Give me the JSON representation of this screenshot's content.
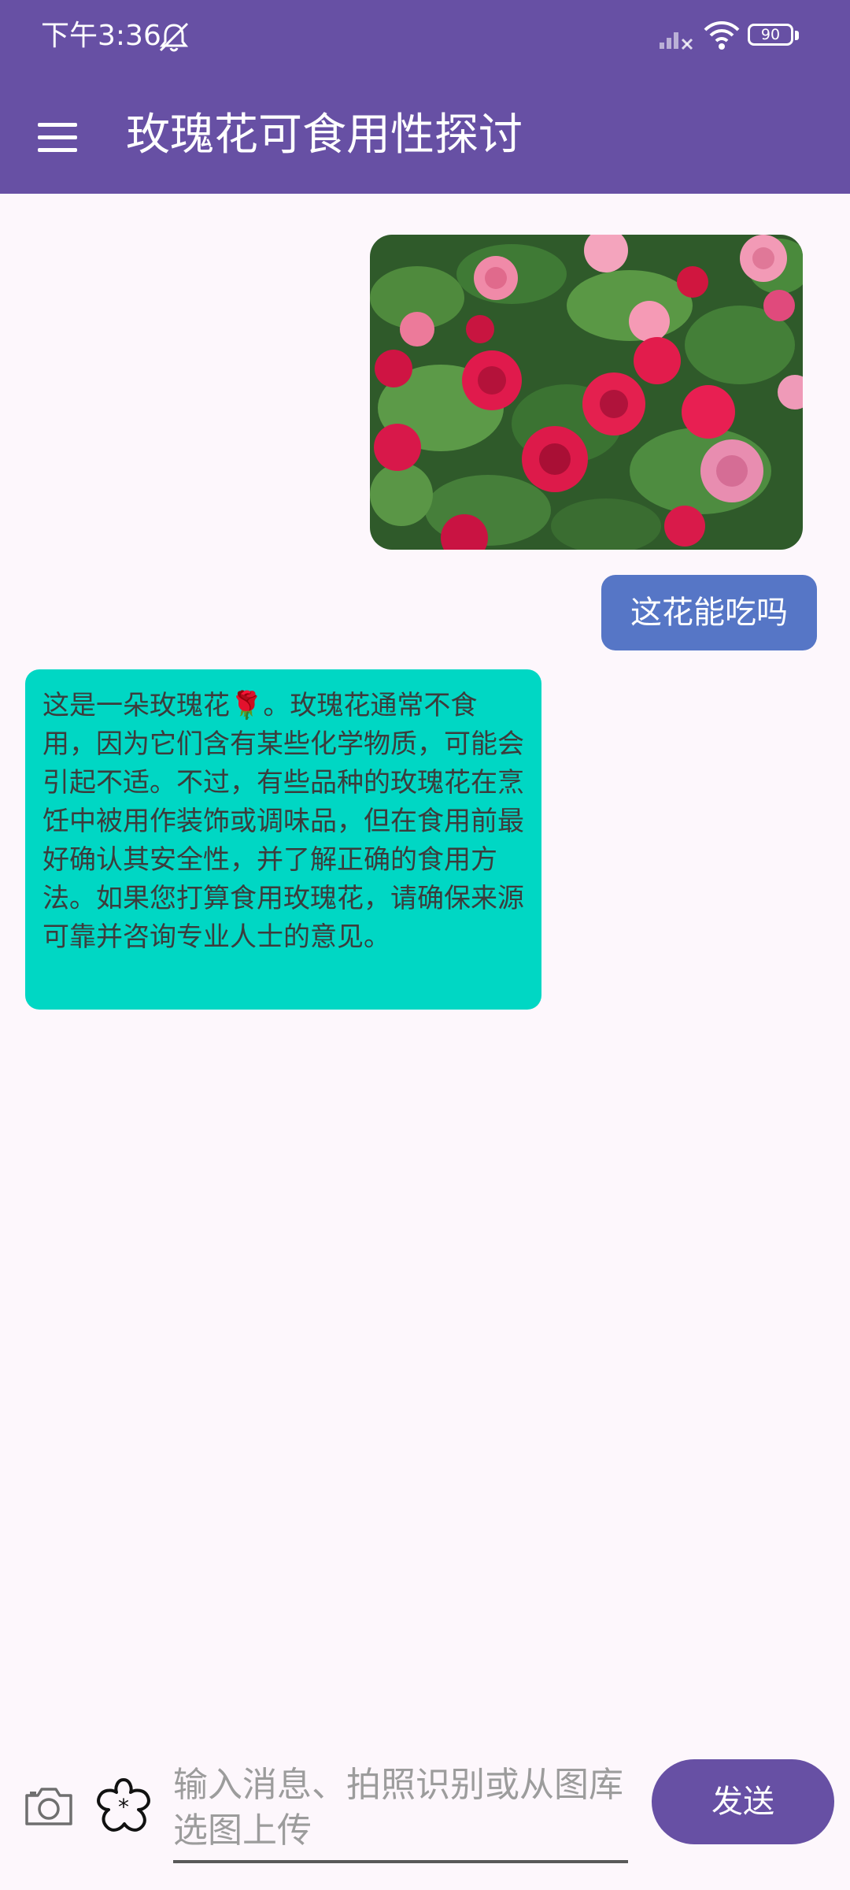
{
  "status_bar": {
    "time": "下午3:36",
    "battery": "90"
  },
  "app_bar": {
    "title": "玫瑰花可食用性探讨"
  },
  "chat": {
    "messages": [
      {
        "role": "user",
        "type": "image"
      },
      {
        "role": "user",
        "type": "text",
        "text": "这花能吃吗"
      },
      {
        "role": "assistant",
        "type": "text",
        "text": "这是一朵玫瑰花🌹。玫瑰花通常不食用，因为它们含有某些化学物质，可能会引起不适。不过，有些品种的玫瑰花在烹饪中被用作装饰或调味品，但在食用前最好确认其安全性，并了解正确的食用方法。如果您打算食用玫瑰花，请确保来源可靠并咨询专业人士的意见。"
      }
    ]
  },
  "input_bar": {
    "placeholder": "输入消息、拍照识别或从图库选图上传",
    "send_label": "发送"
  },
  "colors": {
    "primary": "#6750a4",
    "user_bubble": "#5676c6",
    "assistant_bubble": "#00d7c4",
    "background": "#fdf7fc"
  }
}
